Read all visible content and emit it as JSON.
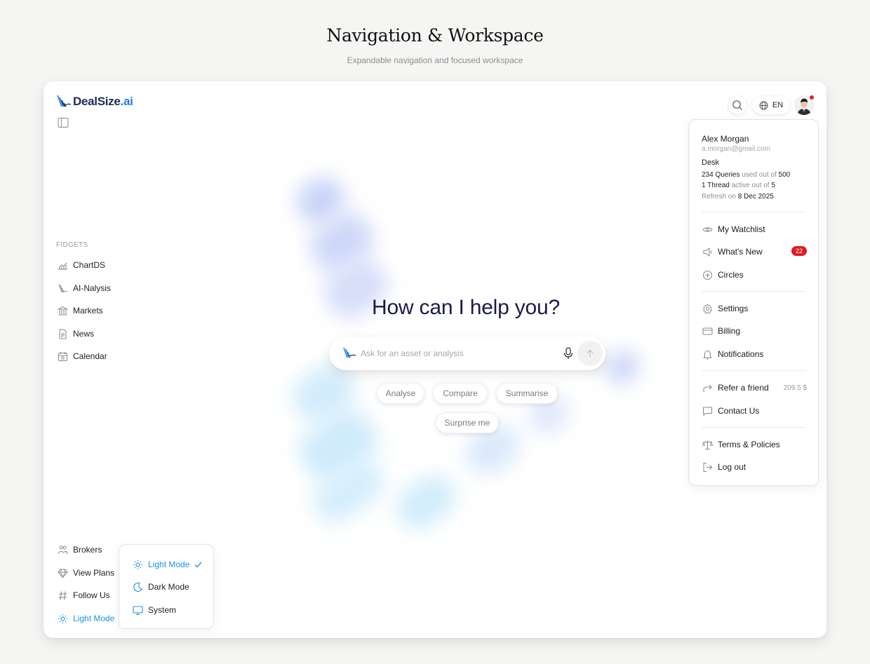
{
  "page": {
    "title": "Navigation & Workspace",
    "subtitle": "Expandable navigation and focused workspace"
  },
  "brand": {
    "name": "DealSize",
    "suffix": ".ai"
  },
  "sidebar": {
    "section_label": "FIDGETS",
    "items": [
      {
        "label": "ChartDS",
        "icon": "chart-icon"
      },
      {
        "label": "AI-Nalysis",
        "icon": "ai-nalysis-icon"
      },
      {
        "label": "Markets",
        "icon": "bank-icon"
      },
      {
        "label": "News",
        "icon": "document-icon"
      },
      {
        "label": "Calendar",
        "icon": "calendar-icon"
      }
    ],
    "bottom_items": [
      {
        "label": "Brokers",
        "icon": "handshake-icon"
      },
      {
        "label": "View Plans",
        "icon": "diamond-icon"
      },
      {
        "label": "Follow Us",
        "icon": "hash-icon"
      },
      {
        "label": "Light Mode",
        "icon": "sun-icon"
      }
    ]
  },
  "theme_menu": {
    "options": [
      {
        "label": "Light Mode",
        "icon": "sun-icon",
        "selected": true
      },
      {
        "label": "Dark Mode",
        "icon": "moon-icon",
        "selected": false
      },
      {
        "label": "System",
        "icon": "monitor-icon",
        "selected": false
      }
    ]
  },
  "main": {
    "heading": "How can I help you?",
    "search_placeholder": "Ask for an asset or analysis",
    "chips": [
      "Analyse",
      "Compare",
      "Summarise",
      "Surprise me"
    ]
  },
  "topbar": {
    "language": "EN"
  },
  "user_menu": {
    "name": "Alex Morgan",
    "email": "a.morgan@gmail.com",
    "plan": "Desk",
    "queries_used": "234 Queries",
    "queries_text": "used out of",
    "queries_total": "500",
    "threads_active": "1 Thread",
    "threads_text": "active out of",
    "threads_total": "5",
    "refresh_text": "Refresh on",
    "refresh_date": "8 Dec 2025",
    "group1": [
      {
        "label": "My Watchlist",
        "icon": "eye-icon"
      },
      {
        "label": "What's New",
        "icon": "megaphone-icon",
        "badge": "22"
      },
      {
        "label": "Circles",
        "icon": "plus-circle-icon"
      }
    ],
    "group2": [
      {
        "label": "Settings",
        "icon": "gear-icon"
      },
      {
        "label": "Billing",
        "icon": "card-icon"
      },
      {
        "label": "Notifications",
        "icon": "bell-icon"
      }
    ],
    "group3": [
      {
        "label": "Refer a friend",
        "icon": "share-icon",
        "amount": "209.5 $"
      },
      {
        "label": "Contact Us",
        "icon": "chat-icon"
      }
    ],
    "group4": [
      {
        "label": "Terms & Policies",
        "icon": "scale-icon"
      },
      {
        "label": "Log out",
        "icon": "logout-icon"
      }
    ]
  },
  "colors": {
    "accent": "#1a93e2",
    "badge": "#e01b24",
    "heading": "#1b1a4a"
  }
}
